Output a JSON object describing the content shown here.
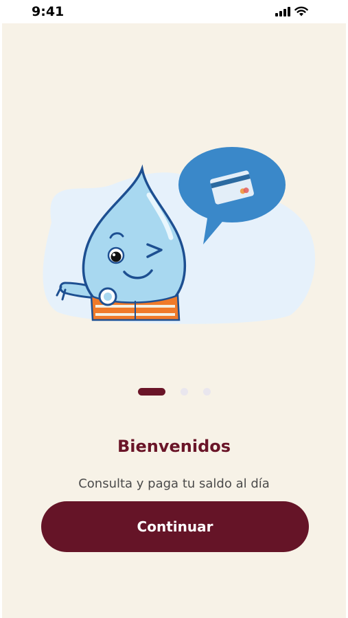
{
  "status_bar": {
    "time": "9:41",
    "icons": [
      "cellular-signal-icon",
      "wifi-icon"
    ]
  },
  "onboarding": {
    "illustration": "water-drop-mascot-with-credit-card-speech-bubble",
    "pager": {
      "total": 3,
      "active": 1
    },
    "title": "Bienvenidos",
    "subtitle": "Consulta y paga tu saldo al día",
    "continue_label": "Continuar"
  },
  "colors": {
    "background": "#f7f2e7",
    "brand": "#651427",
    "inactive_dot": "#e9e6ee",
    "subtitle_text": "#4a4a4a"
  }
}
